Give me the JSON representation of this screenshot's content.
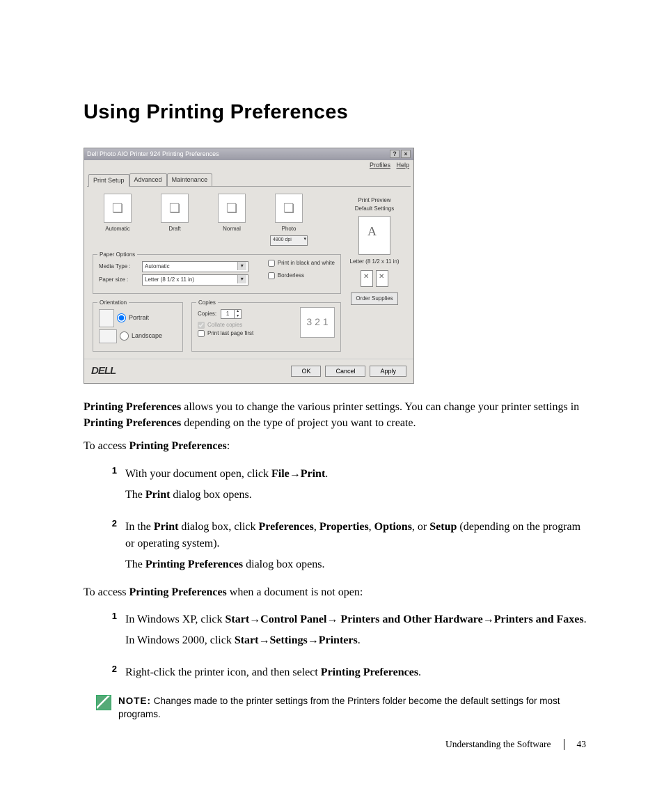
{
  "heading": "Using Printing Preferences",
  "dialog": {
    "title": "Dell Photo AIO Printer 924 Printing Preferences",
    "menu": {
      "profiles": "Profiles",
      "help": "Help"
    },
    "tabs": [
      "Print Setup",
      "Advanced",
      "Maintenance"
    ],
    "quality": {
      "automatic": "Automatic",
      "draft": "Draft",
      "normal": "Normal",
      "photo": "Photo",
      "photo_dpi": "4800 dpi"
    },
    "side": {
      "print_preview": "Print Preview",
      "default_settings": "Default Settings",
      "paper_desc": "Letter (8 1/2 x 11 in)",
      "order": "Order Supplies"
    },
    "paper": {
      "legend": "Paper Options",
      "media_label": "Media Type :",
      "media_value": "Automatic",
      "size_label": "Paper size :",
      "size_value": "Letter (8 1/2 x 11 in)",
      "bw": "Print in black and white",
      "borderless": "Borderless"
    },
    "orient": {
      "legend": "Orientation",
      "portrait": "Portrait",
      "landscape": "Landscape"
    },
    "copies": {
      "legend": "Copies",
      "label": "Copies:",
      "value": "1",
      "collate": "Collate copies",
      "lastfirst": "Print last page first"
    },
    "buttons": {
      "ok": "OK",
      "cancel": "Cancel",
      "apply": "Apply"
    },
    "logo": "DELL"
  },
  "p1": {
    "t1": "Printing Preferences",
    "t2": " allows you to change the various printer settings. You can change your printer settings in ",
    "t3": "Printing Preferences",
    "t4": " depending on the type of project you want to create."
  },
  "p2": {
    "t1": "To access ",
    "t2": "Printing Preferences",
    "t3": ":"
  },
  "s1": {
    "n1": "1",
    "l1a": "With your document open, click ",
    "l1b": "File",
    "l1arrow": "→",
    "l1c": "Print",
    "l1d": ".",
    "l1e1": "The ",
    "l1e2": "Print",
    "l1e3": " dialog box opens.",
    "n2": "2",
    "l2a": "In the ",
    "l2b": "Print",
    "l2c": " dialog box, click ",
    "l2d": "Preferences",
    "l2e": ", ",
    "l2f": "Properties",
    "l2g": ", ",
    "l2h": "Options",
    "l2i": ", or ",
    "l2j": "Setup",
    "l2k": " (depending on the program or operating system).",
    "l2x1": "The ",
    "l2x2": "Printing Preferences",
    "l2x3": " dialog box opens."
  },
  "p3": {
    "t1": "To access ",
    "t2": "Printing Preferences",
    "t3": " when a document is not open:"
  },
  "s2": {
    "n1": "1",
    "l1a": "In Windows XP, click ",
    "l1b": "Start",
    "arr": "→",
    "l1c": "Control Panel",
    "l1d": " Printers and Other Hardware",
    "l1e": "Printers and Faxes",
    "l1f": ".",
    "l1g1": "In Windows 2000, click ",
    "l1g2": "Start",
    "l1g3": "Settings",
    "l1g4": "Printers",
    "l1g5": ".",
    "n2": "2",
    "l2a": "Right-click the printer icon, and then select ",
    "l2b": "Printing Preferences",
    "l2c": "."
  },
  "note": {
    "label": "NOTE:",
    "t1": " Changes made to the printer settings from the ",
    "t2": "Printers",
    "t3": " folder become the default settings for most programs."
  },
  "footer": {
    "section": "Understanding the Software",
    "page": "43"
  }
}
